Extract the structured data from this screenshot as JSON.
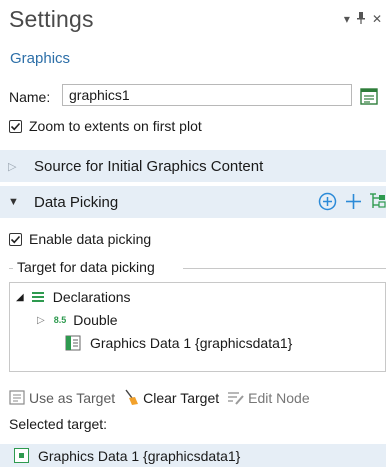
{
  "header": {
    "title": "Settings",
    "subtitle": "Graphics"
  },
  "name": {
    "label": "Name:",
    "value": "graphics1"
  },
  "zoom_checkbox": {
    "label": "Zoom to extents on first plot",
    "checked": true
  },
  "sections": {
    "source": {
      "label": "Source for Initial Graphics Content",
      "expanded": false
    },
    "data_picking": {
      "label": "Data Picking",
      "expanded": true
    }
  },
  "enable_checkbox": {
    "label": "Enable data picking",
    "checked": true
  },
  "target_group": {
    "label": "Target for data picking",
    "tree": {
      "root": "Declarations",
      "child": "Double",
      "child_badge": "8.5",
      "leaf": "Graphics Data 1 {graphicsdata1}"
    }
  },
  "toolbar": {
    "use_as_target": "Use as Target",
    "clear_target": "Clear Target",
    "edit_node": "Edit Node"
  },
  "selected": {
    "label": "Selected target:",
    "value": "Graphics Data 1 {graphicsdata1}"
  },
  "colors": {
    "accent": "#2d6fa8",
    "section_bg": "#e6eef6",
    "add_icon": "#2b8ad8",
    "tree_icon": "#2e9a4f"
  }
}
